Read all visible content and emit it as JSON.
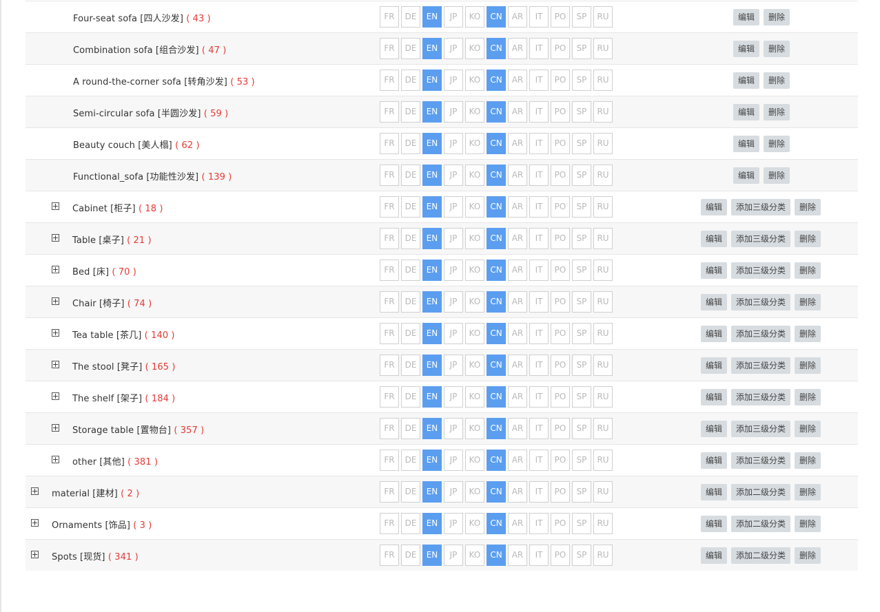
{
  "colors": {
    "active_lang": "#5b9ef0",
    "count_text": "#e53935",
    "button_bg": "#d7dce0",
    "row_alt_bg": "#f7f7f7"
  },
  "languages": [
    "FR",
    "DE",
    "EN",
    "JP",
    "KO",
    "CN",
    "AR",
    "IT",
    "PO",
    "SP",
    "RU"
  ],
  "active_languages": [
    "EN",
    "CN"
  ],
  "actions": {
    "edit": "编辑",
    "delete": "删除",
    "add_third_level": "添加三级分类",
    "add_second_level": "添加二级分类"
  },
  "rows": [
    {
      "level": 3,
      "name": "Four-seat sofa [四人沙发]",
      "count": "( 43 )",
      "expandable": false
    },
    {
      "level": 3,
      "name": "Combination sofa [组合沙发]",
      "count": "( 47 )",
      "expandable": false
    },
    {
      "level": 3,
      "name": "A round-the-corner sofa [转角沙发]",
      "count": "( 53 )",
      "expandable": false
    },
    {
      "level": 3,
      "name": "Semi-circular sofa [半圆沙发]",
      "count": "( 59 )",
      "expandable": false
    },
    {
      "level": 3,
      "name": "Beauty couch [美人榻]",
      "count": "( 62 )",
      "expandable": false
    },
    {
      "level": 3,
      "name": "Functional_sofa [功能性沙发]",
      "count": "( 139 )",
      "expandable": false
    },
    {
      "level": 2,
      "name": "Cabinet [柜子]",
      "count": "( 18 )",
      "expandable": true
    },
    {
      "level": 2,
      "name": "Table [桌子]",
      "count": "( 21 )",
      "expandable": true
    },
    {
      "level": 2,
      "name": "Bed [床]",
      "count": "( 70 )",
      "expandable": true
    },
    {
      "level": 2,
      "name": "Chair [椅子]",
      "count": "( 74 )",
      "expandable": true
    },
    {
      "level": 2,
      "name": "Tea table [茶几]",
      "count": "( 140 )",
      "expandable": true
    },
    {
      "level": 2,
      "name": "The stool [凳子]",
      "count": "( 165 )",
      "expandable": true
    },
    {
      "level": 2,
      "name": "The shelf [架子]",
      "count": "( 184 )",
      "expandable": true
    },
    {
      "level": 2,
      "name": "Storage table [置物台]",
      "count": "( 357 )",
      "expandable": true
    },
    {
      "level": 2,
      "name": "other [其他]",
      "count": "( 381 )",
      "expandable": true
    },
    {
      "level": 1,
      "name": "material [建材]",
      "count": "( 2 )",
      "expandable": true
    },
    {
      "level": 1,
      "name": "Ornaments [饰品]",
      "count": "( 3 )",
      "expandable": true
    },
    {
      "level": 1,
      "name": "Spots [现货]",
      "count": "( 341 )",
      "expandable": true
    }
  ]
}
